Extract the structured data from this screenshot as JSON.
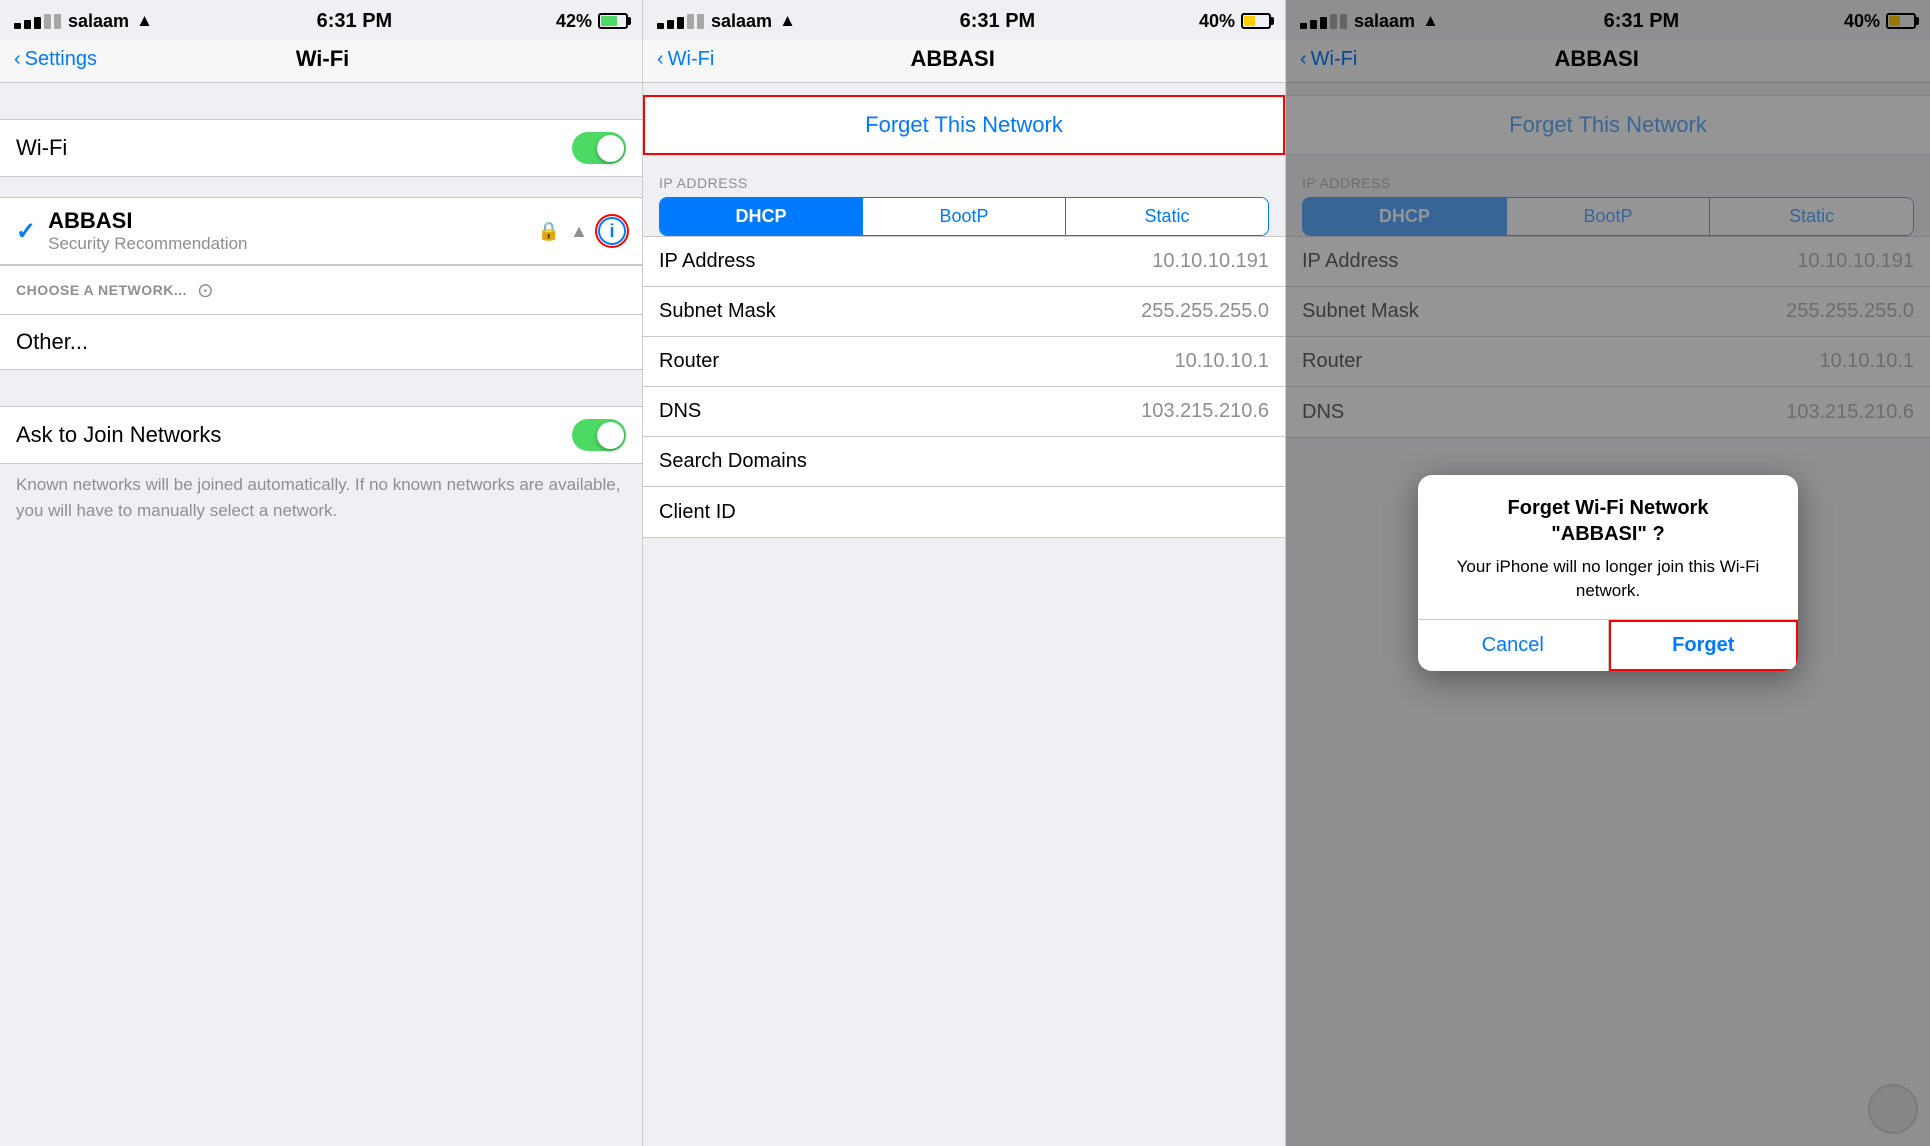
{
  "panel1": {
    "statusBar": {
      "carrier": "salaam",
      "time": "6:31 PM",
      "battery": "42%"
    },
    "navBack": "Settings",
    "navTitle": "Wi-Fi",
    "wifiToggleLabel": "Wi-Fi",
    "wifiOn": true,
    "connectedNetwork": "ABBASI",
    "connectedSub": "Security Recommendation",
    "chooseLabel": "CHOOSE A NETWORK...",
    "otherLabel": "Other...",
    "askLabel": "Ask to Join Networks",
    "askOn": true,
    "askDesc": "Known networks will be joined automatically. If no known networks are available, you will have to manually select a network."
  },
  "panel2": {
    "statusBar": {
      "carrier": "salaam",
      "time": "6:31 PM",
      "battery": "40%"
    },
    "navBack": "Wi-Fi",
    "navTitle": "ABBASI",
    "forgetLabel": "Forget This Network",
    "ipAddressHeader": "IP ADDRESS",
    "segments": [
      "DHCP",
      "BootP",
      "Static"
    ],
    "activeSegment": 0,
    "fields": [
      {
        "key": "IP Address",
        "val": "10.10.10.191"
      },
      {
        "key": "Subnet Mask",
        "val": "255.255.255.0"
      },
      {
        "key": "Router",
        "val": "10.10.10.1"
      },
      {
        "key": "DNS",
        "val": "103.215.210.6"
      },
      {
        "key": "Search Domains",
        "val": ""
      },
      {
        "key": "Client ID",
        "val": ""
      }
    ]
  },
  "panel3": {
    "statusBar": {
      "carrier": "salaam",
      "time": "6:31 PM",
      "battery": "40%"
    },
    "navBack": "Wi-Fi",
    "navTitle": "ABBASI",
    "forgetLabel": "Forget This Network",
    "ipAddressHeader": "IP ADDRESS",
    "segments": [
      "DHCP",
      "BootP",
      "Static"
    ],
    "activeSegment": 0,
    "fields": [
      {
        "key": "IP Address",
        "val": "10.10.10.191"
      },
      {
        "key": "Subnet Mask",
        "val": "255.255.255.0"
      },
      {
        "key": "Router",
        "val": "10.10.10.1"
      },
      {
        "key": "DNS",
        "val": "103.215.210.6"
      },
      {
        "key": "Search Domains",
        "val": ""
      },
      {
        "key": "Client ID",
        "val": ""
      }
    ],
    "dialog": {
      "title": "Forget Wi-Fi Network\n\"ABBASI\" ?",
      "message": "Your iPhone will no longer join this Wi-Fi network.",
      "cancelLabel": "Cancel",
      "forgetLabel": "Forget"
    }
  },
  "icons": {
    "back": "‹",
    "wifi": "📶",
    "lock": "🔒",
    "info": "i",
    "check": "✓"
  }
}
